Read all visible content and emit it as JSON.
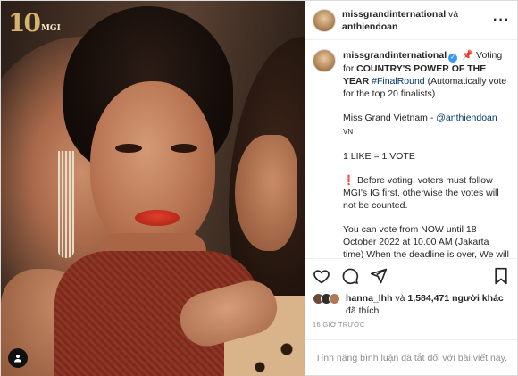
{
  "logo": {
    "number": "10",
    "brand": "MGI"
  },
  "header": {
    "owner": "missgrandinternational",
    "joiner": " và ",
    "coauthor": "anthiendoan",
    "more_icon": "more-horizontal-icon"
  },
  "caption": {
    "author": "missgrandinternational",
    "pin": "📌",
    "line1": "Voting for ",
    "highlight": "COUNTRY'S POWER OF THE YEAR",
    "hashtag": "#FinalRound",
    "line1_rest": " (Automatically vote for the top 20 finalists)",
    "contestant_prefix": "Miss Grand Vietnam - ",
    "contestant_handle": "@anthiendoan",
    "country_code": "VN",
    "rule": "1 LIKE = 1 VOTE",
    "warning_icon": "❗",
    "warning": " Before voting, voters must follow MGI's IG first, otherwise the votes will not be counted.",
    "deadline": "You can vote from NOW until 18 October 2022 at 10.00 AM (Jakarta time) When the deadline is over, We will announce the winner in this round"
  },
  "actions": {
    "like_icon": "heart-icon",
    "comment_icon": "comment-icon",
    "share_icon": "send-icon",
    "save_icon": "bookmark-icon"
  },
  "likes": {
    "first_user": "hanna_lhh",
    "rest": " và ",
    "count": "1,584,471 người khác",
    "suffix": " đã thích"
  },
  "time": "16 GIỜ TRƯỚC",
  "comment": {
    "placeholder": "Tính năng bình luận đã tắt đối với bài viết này."
  }
}
